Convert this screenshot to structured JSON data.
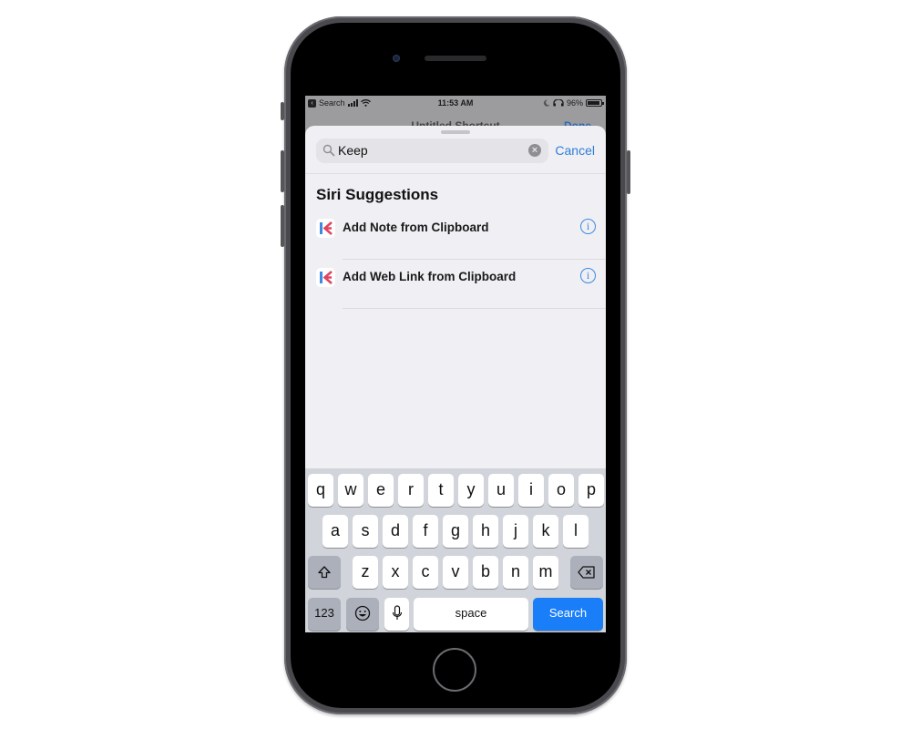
{
  "status_bar": {
    "back_label": "Search",
    "time": "11:53 AM",
    "battery": "96%",
    "battery_level": 0.96
  },
  "background_nav": {
    "title": "Untitled Shortcut",
    "done_label": "Done"
  },
  "search": {
    "value": "Keep",
    "cancel_label": "Cancel"
  },
  "suggestions": {
    "title": "Siri Suggestions",
    "items": [
      {
        "label": "Add Note from Clipboard",
        "icon": "keep-app-icon"
      },
      {
        "label": "Add Web Link from Clipboard",
        "icon": "keep-app-icon"
      }
    ]
  },
  "colors": {
    "accent": "#2f7fd6",
    "search_key": "#1a7ef9",
    "keep_blue": "#3d8ae0",
    "keep_red": "#e0455f"
  },
  "keyboard": {
    "row1": [
      "q",
      "w",
      "e",
      "r",
      "t",
      "y",
      "u",
      "i",
      "o",
      "p"
    ],
    "row2": [
      "a",
      "s",
      "d",
      "f",
      "g",
      "h",
      "j",
      "k",
      "l"
    ],
    "row3": [
      "z",
      "x",
      "c",
      "v",
      "b",
      "n",
      "m"
    ],
    "numbers_label": "123",
    "space_label": "space",
    "search_label": "Search"
  }
}
